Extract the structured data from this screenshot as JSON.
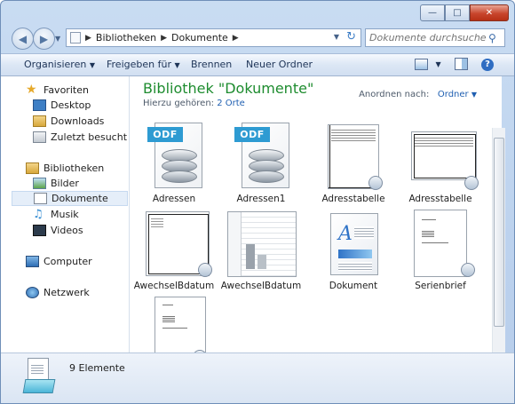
{
  "window": {
    "minimize": "—",
    "maximize": "□",
    "close": "✕"
  },
  "address": {
    "crumb_root": "Bibliotheken",
    "crumb_current": "Dokumente"
  },
  "search": {
    "placeholder": "Dokumente durchsuchen"
  },
  "toolbar": {
    "organize": "Organisieren",
    "share": "Freigeben für",
    "burn": "Brennen",
    "new_folder": "Neuer Ordner"
  },
  "sidebar": {
    "favorites_header": "Favoriten",
    "favorites": [
      {
        "label": "Desktop"
      },
      {
        "label": "Downloads"
      },
      {
        "label": "Zuletzt besucht"
      }
    ],
    "libraries_header": "Bibliotheken",
    "libraries": [
      {
        "label": "Bilder"
      },
      {
        "label": "Dokumente"
      },
      {
        "label": "Musik"
      },
      {
        "label": "Videos"
      }
    ],
    "computer": "Computer",
    "network": "Netzwerk"
  },
  "library": {
    "title": "Bibliothek \"Dokumente\"",
    "sub_prefix": "Hierzu gehören:",
    "sub_link": "2 Orte",
    "arrange_label": "Anordnen nach:",
    "arrange_value": "Ordner"
  },
  "files": [
    {
      "name": "Adressen",
      "type": "odf",
      "badge": "ODF"
    },
    {
      "name": "Adressen1",
      "type": "odf",
      "badge": "ODF"
    },
    {
      "name": "Adresstabelle",
      "type": "doc-thumb"
    },
    {
      "name": "Adresstabelle",
      "type": "doc-thumb-wide"
    },
    {
      "name": "AwechselBdatum",
      "type": "doc-thumb-plain"
    },
    {
      "name": "AwechselBdatum",
      "type": "sheet"
    },
    {
      "name": "Dokument",
      "type": "word"
    },
    {
      "name": "Serienbrief",
      "type": "doc-letter"
    },
    {
      "name": "",
      "type": "doc-letter-partial"
    }
  ],
  "status": {
    "count": "9 Elemente"
  },
  "colors": {
    "title_green": "#1e8c2f",
    "link_blue": "#1f5fb1",
    "odf_blue": "#2e9bd2"
  }
}
